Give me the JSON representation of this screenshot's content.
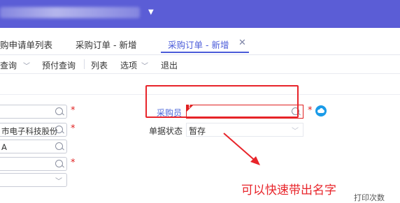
{
  "header": {
    "company_name_caret": "▼",
    "background_color": "#5b5dd6"
  },
  "tabs": [
    {
      "label": "购申请单列表"
    },
    {
      "label": "采购订单 - 新增"
    },
    {
      "label": "采购订单 - 新增",
      "active": true,
      "close": "✕"
    }
  ],
  "toolbar": {
    "items": [
      "查询",
      "预付查询",
      "列表",
      "选项",
      "退出"
    ]
  },
  "left_fields": [
    {
      "value": "",
      "type": "lookup",
      "required": true
    },
    {
      "value": "市电子科技股份有",
      "type": "lookup",
      "required": true
    },
    {
      "value": "A",
      "type": "lookup",
      "required": false
    },
    {
      "value": "",
      "type": "lookup",
      "required": true
    },
    {
      "value": "",
      "type": "select",
      "required": false
    }
  ],
  "form": {
    "purchaser_label": "采购员",
    "purchaser_value": "",
    "purchaser_error_mark": "!",
    "status_label": "单据状态",
    "status_value": "暂存",
    "required_mark": "*"
  },
  "annotation": {
    "text": "可以快速带出名字",
    "color": "#e8242a"
  },
  "footer": {
    "print_count": "打印次数"
  },
  "colors": {
    "accent": "#4a5bd9",
    "required": "#e02020"
  }
}
